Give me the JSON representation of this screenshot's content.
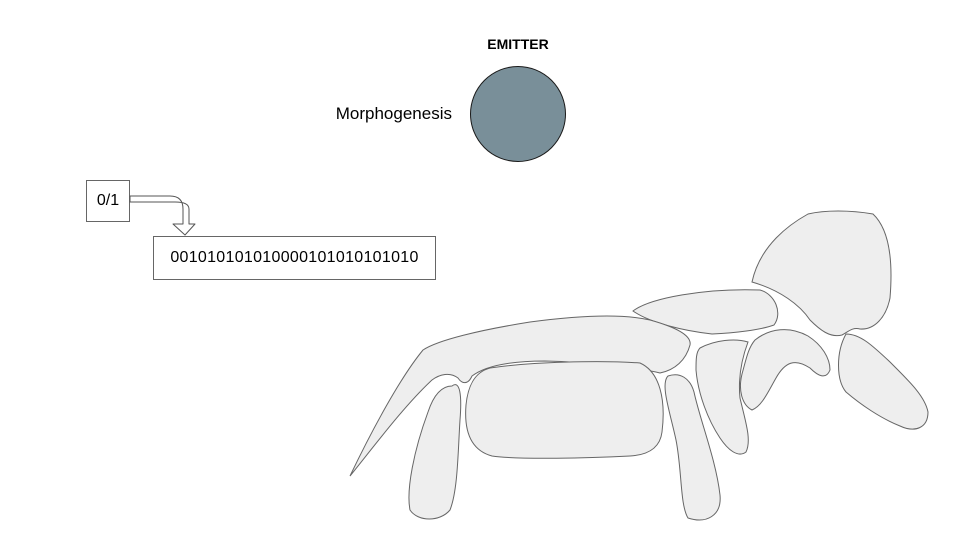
{
  "emitter": {
    "title": "EMITTER",
    "fill_color": "#798f99"
  },
  "morphogenesis_label": "Morphogenesis",
  "bit_box": {
    "text": "0/1"
  },
  "binary_string": {
    "text": "00101010101000010101010101 0"
  },
  "figure": {
    "fill_color": "#eeeeee",
    "stroke_color": "#666666"
  }
}
